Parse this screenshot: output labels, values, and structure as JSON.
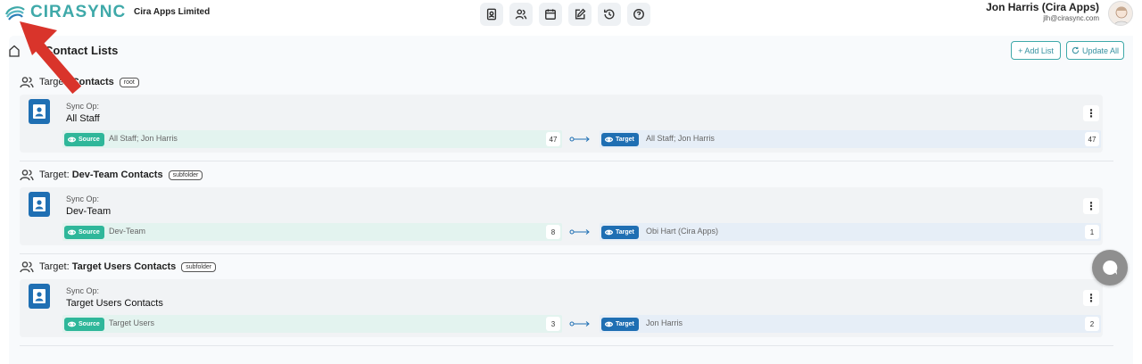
{
  "brand": {
    "name": "CIRASYNC",
    "accent": "#3fa9a9"
  },
  "header": {
    "org_name": "Cira Apps Limited",
    "nav_icons": [
      "contact-card-icon",
      "users-icon",
      "calendar-icon",
      "edit-icon",
      "history-icon",
      "help-icon"
    ],
    "user_name": "Jon Harris (Cira Apps)",
    "user_email": "jlh@cirasync.com"
  },
  "page": {
    "title": "Contact Lists",
    "add_list_label": "+ Add List",
    "update_all_label": "Update All"
  },
  "labels": {
    "sync_op": "Sync Op:",
    "source": "Source",
    "target": "Target",
    "target_prefix": "Target:"
  },
  "sections": [
    {
      "title_prefix": "Target:",
      "title": "Contacts",
      "badge": "root",
      "op_name": "All Staff",
      "source_text": "All Staff; Jon Harris",
      "source_count": "47",
      "target_text": "All Staff; Jon Harris",
      "target_count": "47"
    },
    {
      "title_prefix": "Target:",
      "title": "Dev-Team Contacts",
      "badge": "subfolder",
      "op_name": "Dev-Team",
      "source_text": "Dev-Team",
      "source_count": "8",
      "target_text": "Obi Hart (Cira Apps)",
      "target_count": "1"
    },
    {
      "title_prefix": "Target:",
      "title": "Target Users Contacts",
      "badge": "subfolder",
      "op_name": "Target Users Contacts",
      "source_text": "Target Users",
      "source_count": "3",
      "target_text": "Jon Harris",
      "target_count": "2"
    }
  ],
  "colors": {
    "source": "#2fb79a",
    "target": "#1f6fb3",
    "annotation": "#d9342b"
  }
}
